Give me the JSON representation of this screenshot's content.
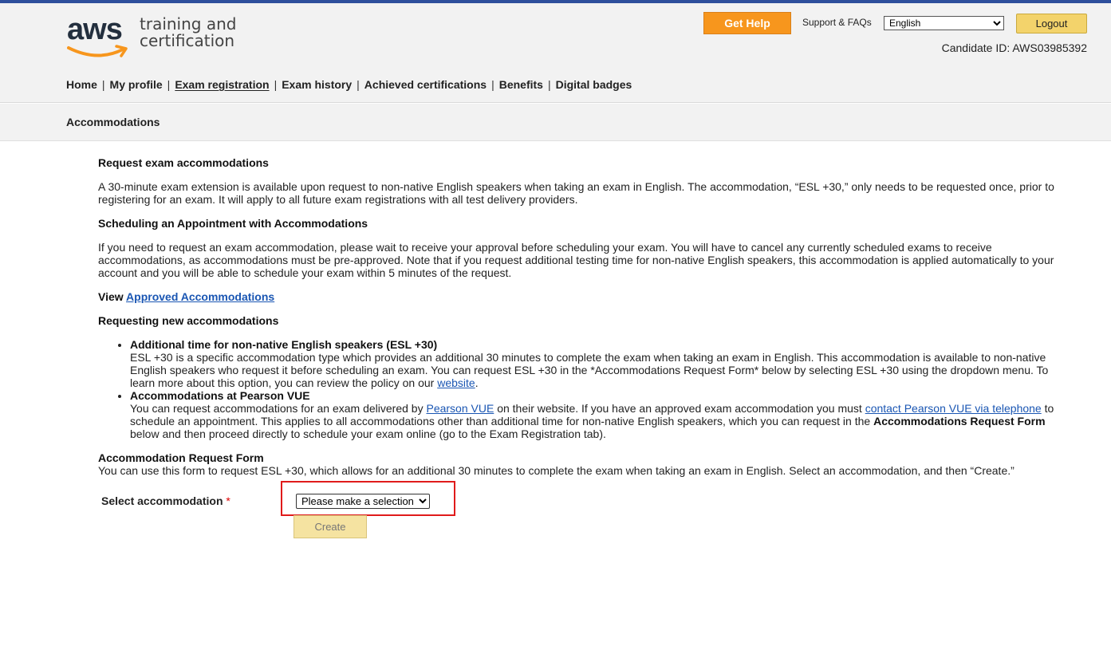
{
  "brand": {
    "logo_word": "aws",
    "logo_line1": "training and",
    "logo_line2": "certification"
  },
  "header": {
    "get_help": "Get Help",
    "support": "Support & FAQs",
    "language": "English",
    "logout": "Logout",
    "candidate_id": "Candidate ID: AWS03985392"
  },
  "nav": {
    "items": [
      "Home",
      "My profile",
      "Exam registration",
      "Exam history",
      "Achieved certifications",
      "Benefits",
      "Digital badges"
    ],
    "separator": "|",
    "active": "Exam registration"
  },
  "subbar": {
    "title": "Accommodations"
  },
  "content": {
    "h1": "Request exam accommodations",
    "p1": "A 30-minute exam extension is available upon request to non-native English speakers when taking an exam in English. The accommodation, “ESL +30,” only needs to be requested once, prior to registering for an exam. It will apply to all future exam registrations with all test delivery providers.",
    "h2": "Scheduling an Appointment with Accommodations",
    "p2": "If you need to request an exam accommodation, please wait to receive your approval before scheduling your exam. You will have to cancel any currently scheduled exams to receive accommodations, as accommodations must be pre-approved. Note that if you request additional testing time for non-native English speakers, this accommodation is applied automatically to your account and you will be able to schedule your exam within 5 minutes of the request.",
    "view_prefix": "View",
    "view_link": "Approved Accommodations",
    "h3": "Requesting new accommodations",
    "b1_title": "Additional time for non-native English speakers (ESL +30)",
    "b1_text": "ESL +30 is a specific accommodation type which provides an additional 30 minutes to complete the exam when taking an exam in English. This accommodation is available to non-native English speakers who request it before scheduling an exam. You can request ESL +30 in the *Accommodations Request Form* below by selecting ESL +30 using the dropdown menu. To learn more about this option, you can review the policy on our",
    "b1_link": "website",
    "b1_end": ".",
    "b2_title": "Accommodations at Pearson VUE",
    "b2_text1": "You can request accommodations for an exam delivered by",
    "b2_link1": "Pearson VUE",
    "b2_text2": "on their website. If you have an approved exam accommodation you must",
    "b2_link2": "contact Pearson VUE via telephone",
    "b2_text3": "to schedule an appointment. This applies to all accommodations other than additional time for non-native English speakers, which you can request in the",
    "b2_bold": "Accommodations Request Form",
    "b2_text4": "below and then proceed directly to schedule your exam online (go to the Exam Registration tab).",
    "h4": "Accommodation Request Form",
    "p4": "You can use this form to request ESL +30, which allows for an additional 30 minutes to complete the exam when taking an exam in English. Select an accommodation, and then “Create.”"
  },
  "form": {
    "label": "Select accommodation",
    "required": "*",
    "select_value": "Please make a selection",
    "create": "Create"
  }
}
